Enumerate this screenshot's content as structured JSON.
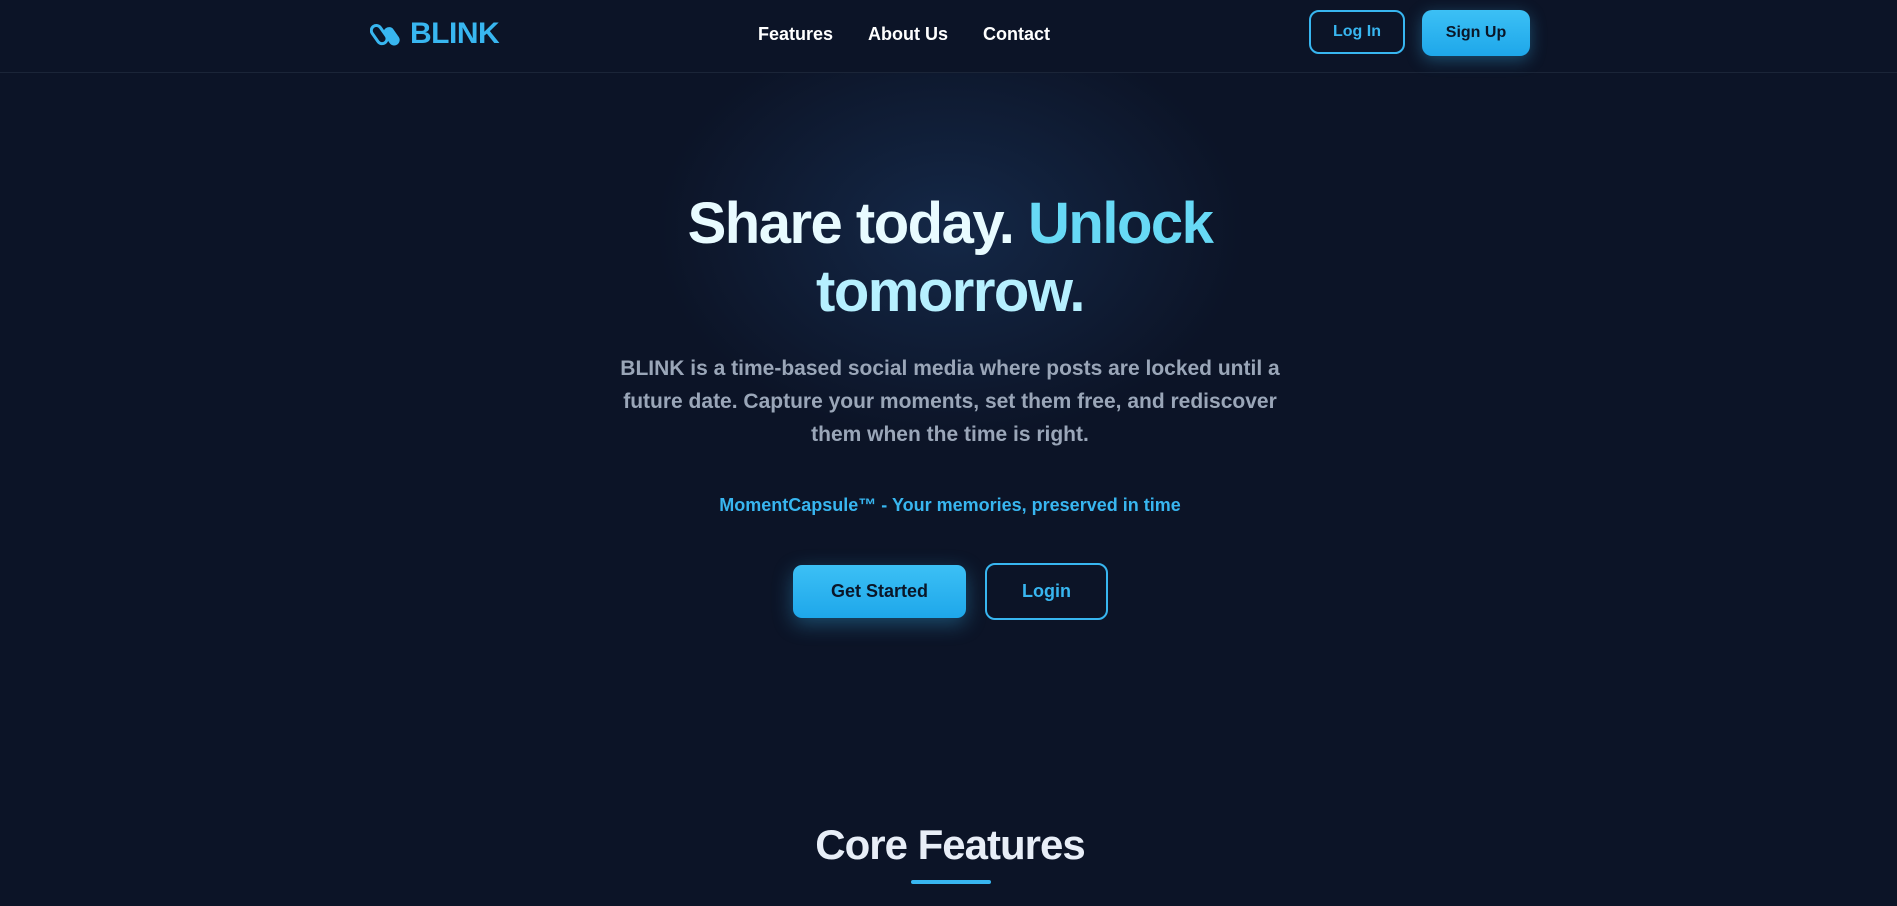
{
  "brand": {
    "name": "BLINK",
    "accent_color": "#38b6f0",
    "icon": "capsule-icon"
  },
  "nav": {
    "links": [
      "Features",
      "About Us",
      "Contact"
    ],
    "login_label": "Log In",
    "signup_label": "Sign Up"
  },
  "hero": {
    "title_part1": "Share today.",
    "title_part2": "Unlock",
    "title_part3": "tomorrow.",
    "description": "BLINK is a time-based social media where posts are locked until a future date. Capture your moments, set them free, and rediscover them when the time is right.",
    "tagline": "MomentCapsule™ - Your memories, preserved in time",
    "primary_button": "Get Started",
    "secondary_button": "Login"
  },
  "features_section": {
    "title": "Core Features"
  }
}
